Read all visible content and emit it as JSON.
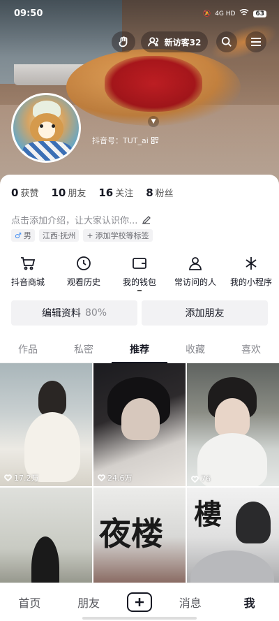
{
  "status_bar": {
    "time": "09:50",
    "network": "4G HD",
    "battery": "63"
  },
  "header": {
    "visitors_label": "新访客32",
    "douyin_id": "抖音号：TUT_ai"
  },
  "stats": [
    {
      "value": "0",
      "label": "获赞"
    },
    {
      "value": "10",
      "label": "朋友"
    },
    {
      "value": "16",
      "label": "关注"
    },
    {
      "value": "8",
      "label": "粉丝"
    }
  ],
  "bio": {
    "placeholder": "点击添加介绍，让大家认识你..."
  },
  "tags": {
    "gender": "男",
    "gender_symbol": "♂",
    "location": "江西·抚州",
    "add_school": "添加学校等标签"
  },
  "shortcuts": [
    {
      "label": "抖音商城",
      "icon": "cart-icon"
    },
    {
      "label": "观看历史",
      "icon": "clock-icon"
    },
    {
      "label": "我的钱包",
      "icon": "wallet-icon"
    },
    {
      "label": "常访问的人",
      "icon": "person-icon"
    },
    {
      "label": "我的小程序",
      "icon": "asterisk-icon"
    }
  ],
  "buttons": {
    "edit_profile": "编辑资料",
    "edit_percent": "80%",
    "add_friend": "添加朋友"
  },
  "tabs": [
    "作品",
    "私密",
    "推荐",
    "收藏",
    "喜欢"
  ],
  "active_tab": "推荐",
  "videos": [
    {
      "likes": "17.2万"
    },
    {
      "likes": "24.6万"
    },
    {
      "likes": "76"
    },
    {
      "likes": ""
    },
    {
      "likes": ""
    },
    {
      "likes": ""
    }
  ],
  "nav": {
    "home": "首页",
    "friends": "朋友",
    "messages": "消息",
    "me": "我"
  }
}
